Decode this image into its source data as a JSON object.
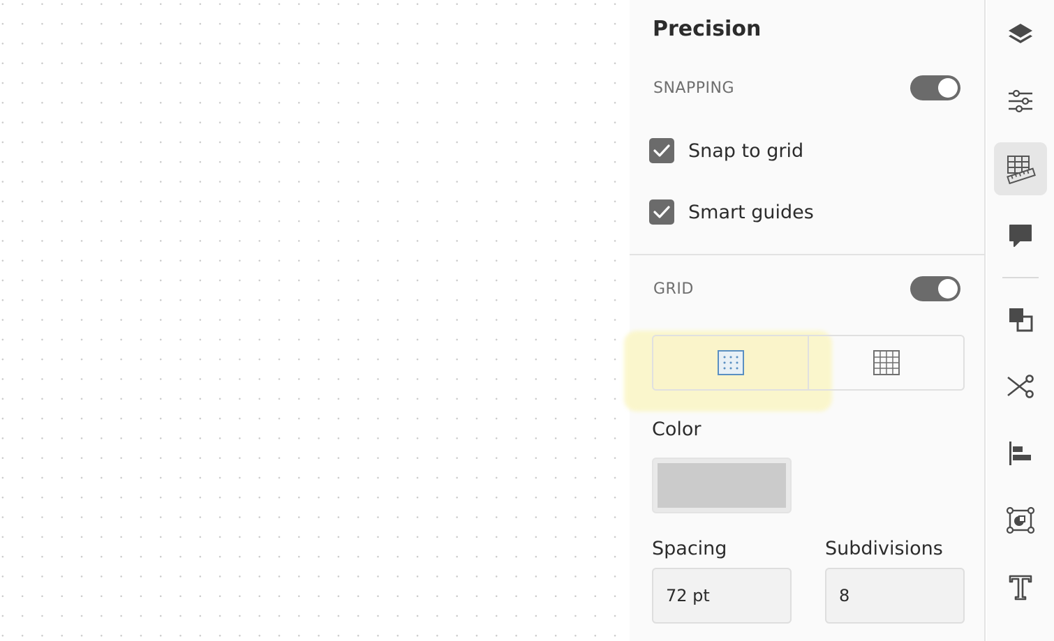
{
  "panel": {
    "title": "Precision",
    "snapping": {
      "label": "SNAPPING",
      "enabled": true,
      "options": [
        {
          "label": "Snap to grid",
          "checked": true
        },
        {
          "label": "Smart guides",
          "checked": true
        }
      ]
    },
    "grid": {
      "label": "GRID",
      "enabled": true,
      "type_options": [
        "dot-grid-icon",
        "line-grid-icon"
      ],
      "selected_type": "dot-grid-icon",
      "color_label": "Color",
      "color_value": "#cbcbcb",
      "spacing_label": "Spacing",
      "spacing_value": "72 pt",
      "subdivisions_label": "Subdivisions",
      "subdivisions_value": "8"
    }
  },
  "rail": {
    "icons": [
      "layers-icon",
      "properties-sliders-icon",
      "precision-grid-ruler-icon",
      "comments-icon",
      "arrange-icon",
      "scissors-icon",
      "align-left-icon",
      "transform-icon",
      "text-icon"
    ],
    "active": "precision-grid-ruler-icon"
  },
  "colors": {
    "accent_gray": "#6b6b6b",
    "highlight": "#fbf6c4",
    "grid_selected": "#5a8fc2"
  }
}
